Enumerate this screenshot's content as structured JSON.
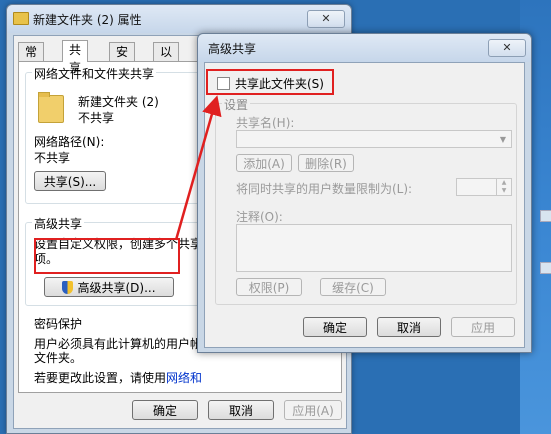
{
  "back_window": {
    "title": "新建文件夹 (2) 属性",
    "tabs": [
      "常规",
      "共享",
      "安全",
      "以前的版"
    ],
    "network_group_title": "网络文件和文件夹共享",
    "folder_name": "新建文件夹 (2)",
    "folder_status": "不共享",
    "network_path_label": "网络路径(N):",
    "network_path_value": "不共享",
    "share_button": "共享(S)...",
    "advanced_group_title": "高级共享",
    "advanced_desc_line1": "设置自定义权限，创建多个共享",
    "advanced_desc_line2": "项。",
    "advanced_share_button": "高级共享(D)...",
    "password_group_title": "密码保护",
    "password_desc_line1": "用户必须具有此计算机的用户帐",
    "password_desc_line2": "文件夹。",
    "password_change_text": "若要更改此设置，请使用",
    "password_link": "网络和",
    "ok": "确定",
    "cancel": "取消",
    "apply": "应用(A)"
  },
  "front_window": {
    "title": "高级共享",
    "share_checkbox_label": "共享此文件夹(S)",
    "settings_group_title": "设置",
    "share_name_label": "共享名(H):",
    "add_button": "添加(A)",
    "remove_button": "删除(R)",
    "limit_label": "将同时共享的用户数量限制为(L):",
    "comment_label": "注释(O):",
    "permissions_button": "权限(P)",
    "cache_button": "缓存(C)",
    "ok": "确定",
    "cancel": "取消",
    "apply": "应用"
  },
  "colors": {
    "highlight": "#e02020",
    "titlebar": "#c6d6ea",
    "desktop": "#2a6fb4"
  }
}
